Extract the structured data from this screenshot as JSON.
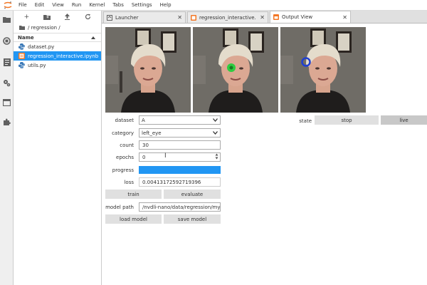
{
  "menu": [
    "File",
    "Edit",
    "View",
    "Run",
    "Kernel",
    "Tabs",
    "Settings",
    "Help"
  ],
  "file_browser": {
    "path": "/ regression /",
    "column_name": "Name",
    "files": [
      {
        "name": "dataset.py",
        "selected": false
      },
      {
        "name": "regression_interactive.ipynb",
        "selected": true
      },
      {
        "name": "utils.py",
        "selected": false
      }
    ]
  },
  "tabs": [
    {
      "label": "Launcher",
      "active": false
    },
    {
      "label": "regression_interactive.ipynb",
      "active": false
    },
    {
      "label": "Output View",
      "active": true
    }
  ],
  "widgets": {
    "dataset_label": "dataset",
    "dataset_value": "A",
    "category_label": "category",
    "category_value": "left_eye",
    "count_label": "count",
    "count_value": "30",
    "epochs_label": "epochs",
    "epochs_value": "0",
    "progress_label": "progress",
    "progress_value": 1.0,
    "loss_label": "loss",
    "loss_value": "0.00413172592719396",
    "train_label": "train",
    "evaluate_label": "evaluate",
    "model_path_label": "model path",
    "model_path_value": "/nvdli-nano/data/regression/my_",
    "load_model_label": "load model",
    "save_model_label": "save model",
    "state_label": "state",
    "stop_label": "stop",
    "live_label": "live"
  },
  "colors": {
    "accent": "#2196f3",
    "marker_green": "#2ecc40",
    "marker_blue": "#1f3fd1"
  }
}
